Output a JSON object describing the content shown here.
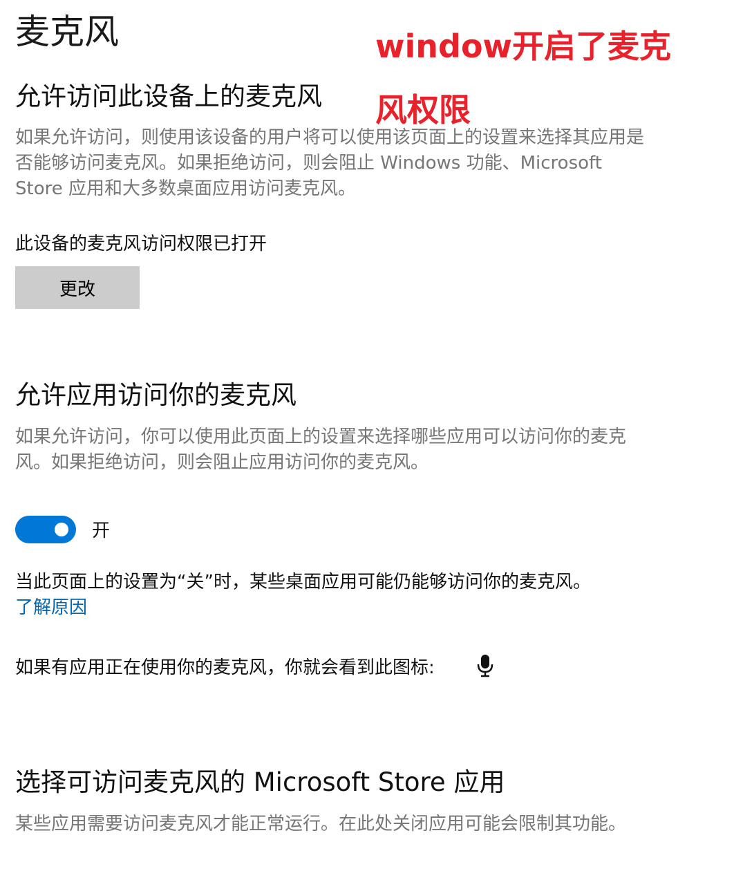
{
  "page": {
    "title": "麦克风"
  },
  "annotation": {
    "line1": "window开启了麦克",
    "line2": "风权限",
    "color": "#e8212b"
  },
  "device_access": {
    "heading": "允许访问此设备上的麦克风",
    "description": "如果允许访问，则使用该设备的用户将可以使用该页面上的设置来选择其应用是否能够访问麦克风。如果拒绝访问，则会阻止 Windows 功能、Microsoft Store 应用和大多数桌面应用访问麦克风。",
    "status": "此设备的麦克风访问权限已打开",
    "change_button_label": "更改"
  },
  "app_access": {
    "heading": "允许应用访问你的麦克风",
    "description": "如果允许访问，你可以使用此页面上的设置来选择哪些应用可以访问你的麦克风。如果拒绝访问，则会阻止应用访问你的麦克风。",
    "toggle_state": "开",
    "toggle_on": true,
    "toggle_color": "#0078d7",
    "note": "当此页面上的设置为“关”时，某些桌面应用可能仍能够访问你的麦克风。",
    "learn_more_link": "了解原因",
    "icon_note": "如果有应用正在使用你的麦克风，你就会看到此图标:",
    "icon_name": "microphone-icon"
  },
  "store_apps": {
    "heading": "选择可访问麦克风的 Microsoft Store 应用",
    "description": "某些应用需要访问麦克风才能正常运行。在此处关闭应用可能会限制其功能。"
  }
}
